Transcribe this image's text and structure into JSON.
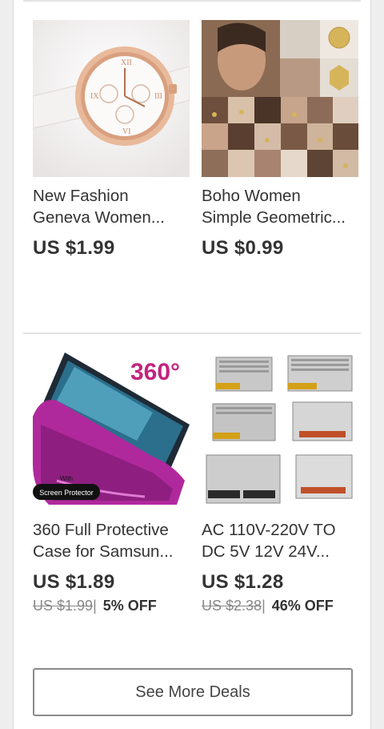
{
  "products": [
    {
      "title_line1": "New Fashion",
      "title_line2": "Geneva Women...",
      "price": "US $1.99",
      "original_price": "",
      "discount": "",
      "image": "rose-gold-watch-image"
    },
    {
      "title_line1": "Boho Women",
      "title_line2": "Simple Geometric...",
      "price": "US $0.99",
      "original_price": "",
      "discount": "",
      "image": "earrings-collage-image"
    },
    {
      "title_line1": "360 Full Protective",
      "title_line2": "Case for Samsun...",
      "price": "US $1.89",
      "original_price": "US $1.99",
      "discount": "5% OFF",
      "image": "phone-case-image"
    },
    {
      "title_line1": "AC 110V-220V TO",
      "title_line2": "DC 5V 12V 24V...",
      "price": "US $1.28",
      "original_price": "US $2.38",
      "discount": "46% OFF",
      "image": "power-supply-image"
    }
  ],
  "phone_case_badge": "360°",
  "phone_case_label_top": "With",
  "phone_case_label_bottom": "Screen Protector",
  "see_more_label": "See More Deals",
  "colors": {
    "text": "#333333",
    "muted": "#888888",
    "divider": "#e3e3e3",
    "case_purple": "#b0299c",
    "badge_magenta": "#c2237f"
  }
}
